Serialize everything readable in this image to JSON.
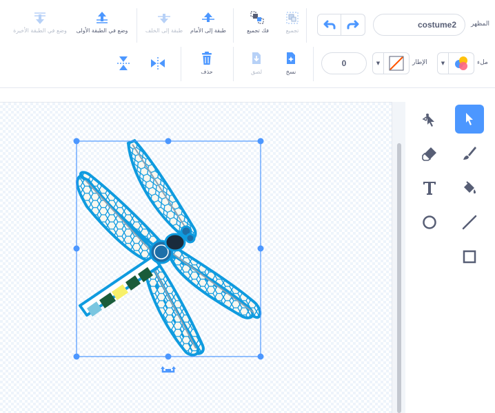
{
  "toolbar": {
    "costume_label": "المظهر",
    "costume_name": "costume2",
    "group_label": "تجميع",
    "ungroup_label": "فك تجميع",
    "forward_label": "طبقة إلى الأمام",
    "backward_label": "طبقة إلى الخلف",
    "front_label": "وضع في الطبقة الأولى",
    "back_label": "وضع في الطبقة الأخيرة",
    "fill_label": "ملء",
    "outline_label": "الإطار",
    "outline_width": "0",
    "copy_label": "نسخ",
    "paste_label": "لصق",
    "delete_label": "حذف"
  },
  "colors": {
    "accent": "#4c97ff",
    "text": "#575e75",
    "disabled": "#b8bfcc",
    "dragonfly_outline": "#0f9bdf",
    "delete_red": "#4c97ff"
  },
  "tools": [
    "reshape-icon",
    "select-icon",
    "eraser-icon",
    "brush-icon",
    "text-icon",
    "fill-icon",
    "circle-icon",
    "line-icon",
    "rectangle-icon"
  ]
}
